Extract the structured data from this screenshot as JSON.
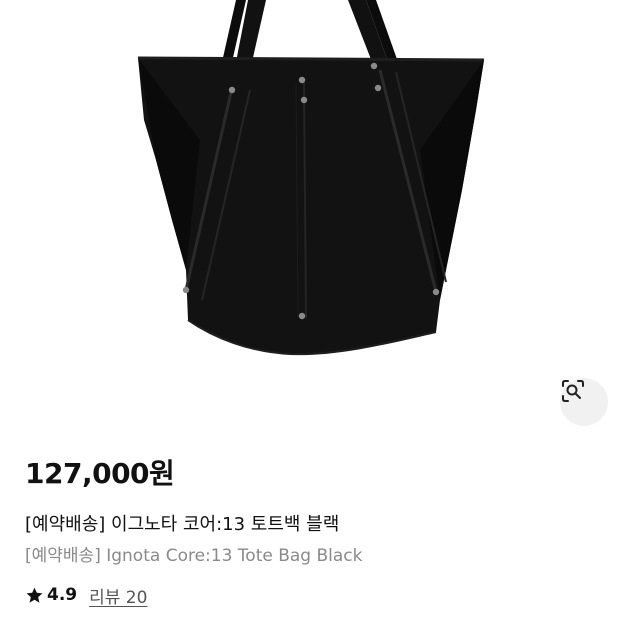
{
  "product": {
    "price": "127,000원",
    "title_ko": "[예약배송] 이그노타 코어:13 토트백 블랙",
    "title_en": "[예약배송] Ignota Core:13 Tote Bag Black",
    "image_icon": "black-tote-bag"
  },
  "actions": {
    "visual_search_icon": "lens-search-icon"
  },
  "rating": {
    "icon": "star-icon",
    "value": "4.9",
    "review_label": "리뷰 20"
  }
}
